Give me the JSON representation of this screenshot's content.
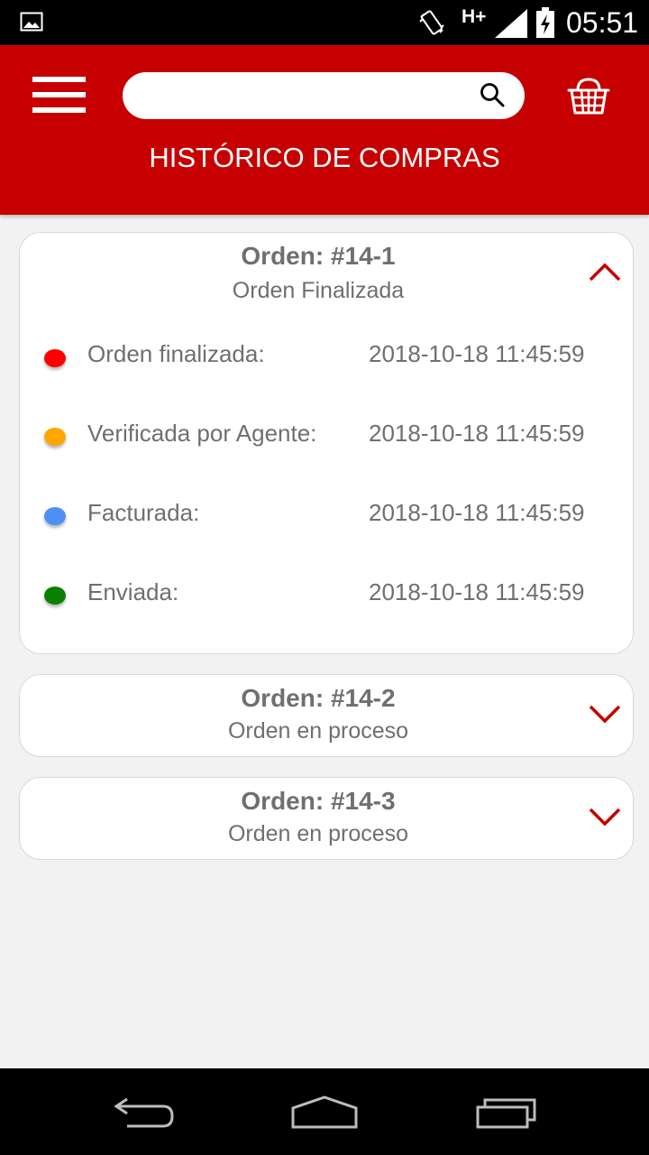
{
  "status_bar": {
    "network": "H+",
    "time": "05:51",
    "icons": [
      "gallery-icon",
      "vibrate-icon",
      "signal-icon",
      "battery-charging-icon"
    ]
  },
  "app_bar": {
    "title": "HISTÓRICO DE COMPRAS",
    "search": {
      "value": "",
      "placeholder": ""
    },
    "menu_icon": "hamburger-menu-icon",
    "search_icon": "search-icon",
    "cart_icon": "shopping-basket-icon",
    "color": "#c60000"
  },
  "orders": [
    {
      "title": "Orden: #14-1",
      "status": "Orden Finalizada",
      "expanded": true,
      "timeline": [
        {
          "label": "Orden finalizada:",
          "time": "2018-10-18 11:45:59",
          "color": "#ff0000"
        },
        {
          "label": "Verificada por Agente:",
          "time": "2018-10-18 11:45:59",
          "color": "#ffa500"
        },
        {
          "label": "Facturada:",
          "time": "2018-10-18 11:45:59",
          "color": "#4d8ff5"
        },
        {
          "label": "Enviada:",
          "time": "2018-10-18 11:45:59",
          "color": "#0a8000"
        }
      ]
    },
    {
      "title": "Orden: #14-2",
      "status": "Orden en proceso",
      "expanded": false
    },
    {
      "title": "Orden: #14-3",
      "status": "Orden en proceso",
      "expanded": false
    }
  ],
  "nav_bar": {
    "buttons": [
      "back-icon",
      "home-icon",
      "recent-apps-icon"
    ]
  }
}
